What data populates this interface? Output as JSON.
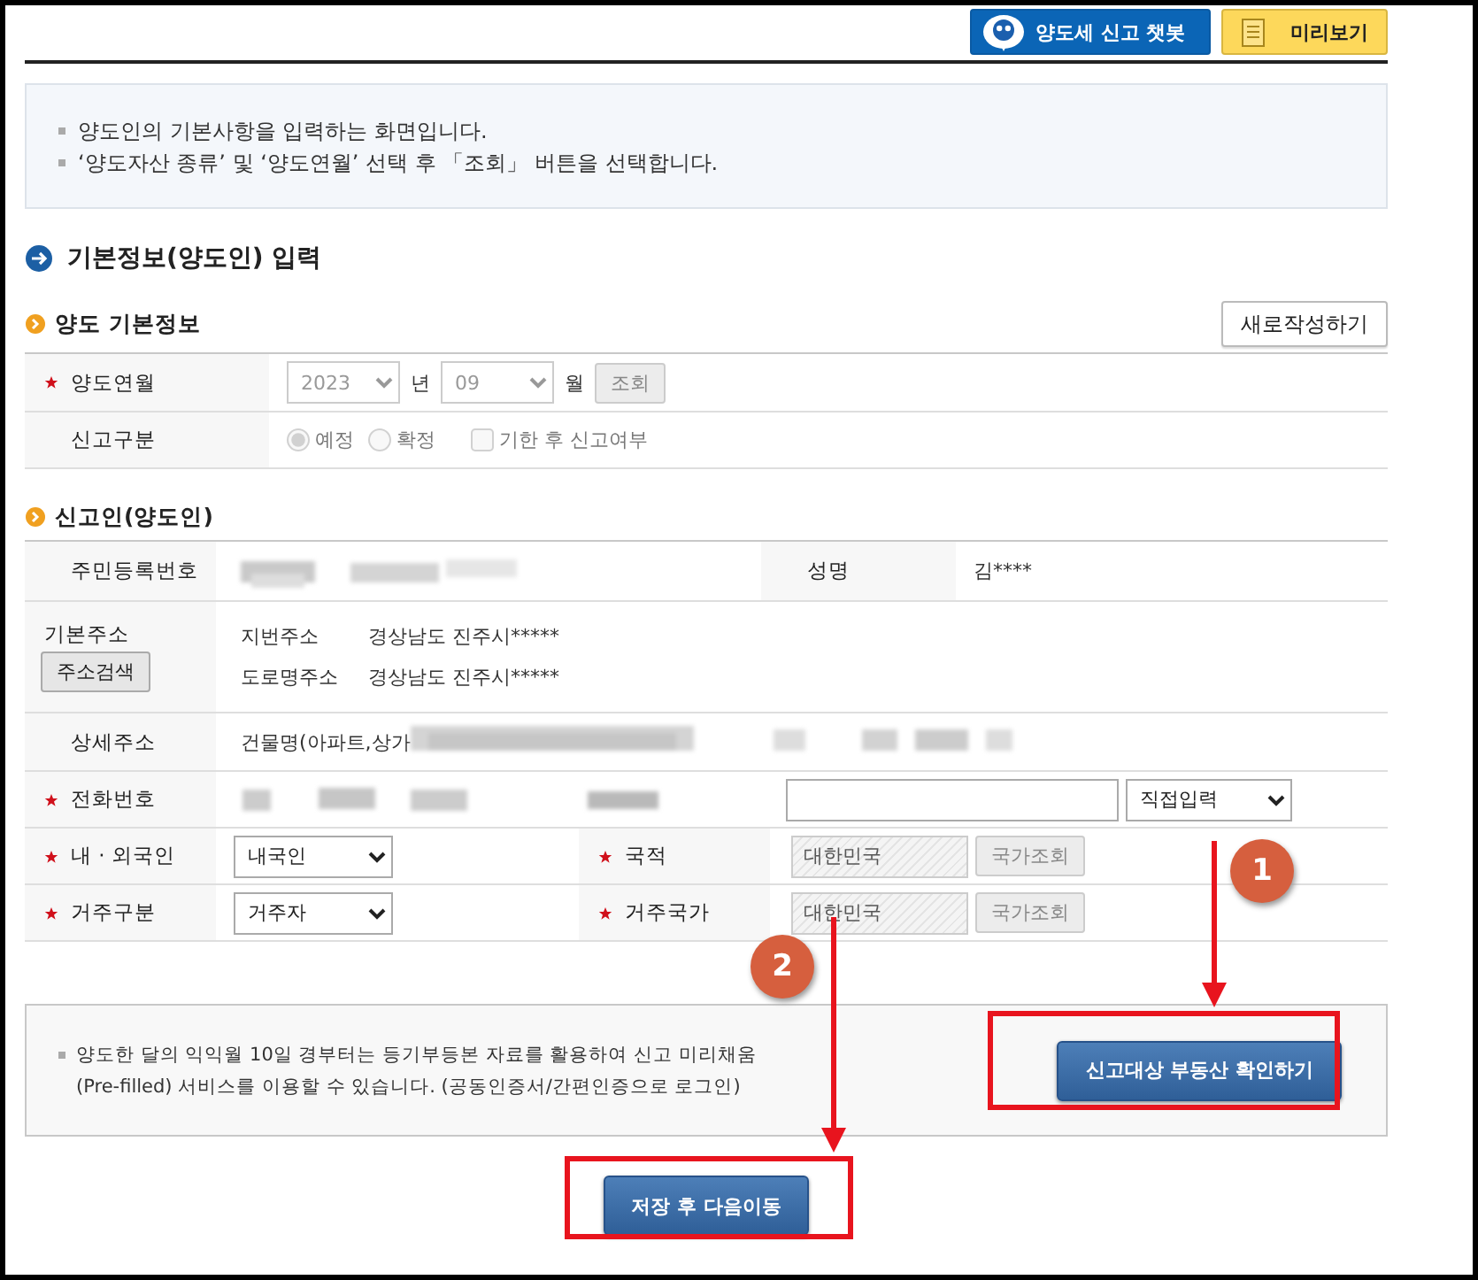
{
  "header_buttons": [
    {
      "kind": "chatbot",
      "label": "양도세 신고 챗봇"
    },
    {
      "kind": "preview",
      "label": "미리보기"
    }
  ],
  "notice": [
    "양도인의 기본사항을 입력하는 화면입니다.",
    "‘양도자산 종류’ 및 ‘양도연월’ 선택 후 「조회」 버튼을 선택합니다."
  ],
  "section_title": "기본정보(양도인) 입력",
  "basic_info": {
    "title": "양도 기본정보",
    "new_button": "새로작성하기",
    "month_row": {
      "label": "양도연월",
      "required": true,
      "disabled": true,
      "year": "2023",
      "year_unit": "년",
      "month": "09",
      "month_unit": "월",
      "button": "조회"
    },
    "report_row": {
      "label": "신고구분",
      "disabled": true,
      "options": [
        {
          "label": "예정",
          "selected": true
        },
        {
          "label": "확정",
          "selected": false
        }
      ],
      "late_check": {
        "label": "기한 후 신고여부",
        "checked": false
      }
    }
  },
  "reporter": {
    "title": "신고인(양도인)",
    "id_row": {
      "label": "주민등록번호",
      "name_label": "성명",
      "name_value": "김****"
    },
    "address_row": {
      "label": "기본주소",
      "button": "주소검색",
      "lines": [
        {
          "label": "지번주소",
          "value": "경상남도 진주시*****"
        },
        {
          "label": "도로명주소",
          "value": "경상남도 진주시*****"
        }
      ]
    },
    "detail_row": {
      "label": "상세주소",
      "value": "건물명(아파트,상가"
    },
    "phone_row": {
      "label": "전화번호",
      "required": true,
      "select": "직접입력"
    },
    "pair_rows": [
      {
        "label": "내 · 외국인",
        "required": true,
        "select": "내국인",
        "label2": "국적",
        "required2": true,
        "field": "대한민국",
        "button": "국가조회"
      },
      {
        "label": "거주구분",
        "required": true,
        "select": "거주자",
        "label2": "거주국가",
        "required2": true,
        "field": "대한민국",
        "button": "국가조회"
      }
    ]
  },
  "prefill_notice": "양도한 달의 익익월 10일 경부터는 등기부등본 자료를 활용하여 신고 미리채움(Pre-filled) 서비스를 이용할 수 있습니다. (공동인증서/간편인증으로 로그인)",
  "check_button": "신고대상 부동산 확인하기",
  "save_button": "저장 후 다음이동",
  "annotations": [
    {
      "number": "1"
    },
    {
      "number": "2"
    }
  ]
}
